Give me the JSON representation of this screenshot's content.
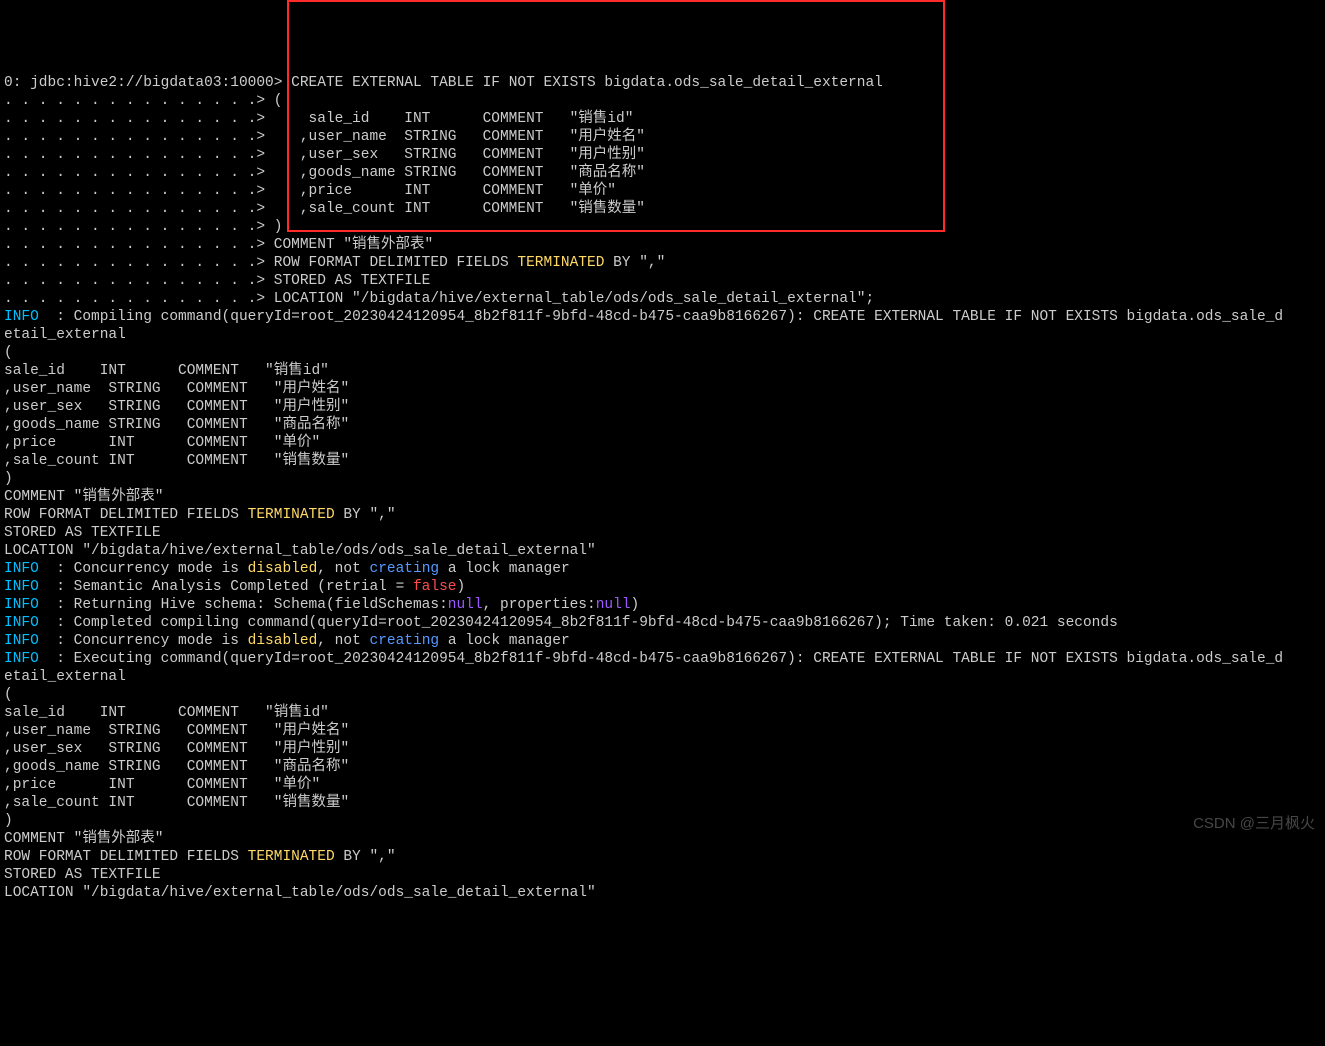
{
  "terminal": {
    "prompt": "0: jdbc:hive2://bigdata03:10000>",
    "continuation": ". . . . . . . . . . . . . . .>",
    "input_lines": [
      " CREATE EXTERNAL TABLE IF NOT EXISTS bigdata.ods_sale_detail_external",
      " (",
      "     sale_id    INT      COMMENT   \"销售id\"",
      "    ,user_name  STRING   COMMENT   \"用户姓名\"",
      "    ,user_sex   STRING   COMMENT   \"用户性别\"",
      "    ,goods_name STRING   COMMENT   \"商品名称\"",
      "    ,price      INT      COMMENT   \"单价\"",
      "    ,sale_count INT      COMMENT   \"销售数量\"",
      " )",
      " COMMENT \"销售外部表\"",
      " ROW FORMAT DELIMITED FIELDS ",
      "TERMINATED",
      " BY \",\"",
      " STORED AS TEXTFILE",
      " LOCATION \"/bigdata/hive/external_table/ods/ods_sale_detail_external\";"
    ],
    "log_compiling_prefix": "  : Compiling command(queryId=root_20230424120954_8b2f811f-9bfd-48cd-b475-caa9b8166267): CREATE EXTERNAL TABLE IF NOT EXISTS bigdata.ods_sale_d",
    "log_compiling_wrap": "etail_external",
    "echo_lines": [
      "(",
      "sale_id    INT      COMMENT   \"销售id\"",
      ",user_name  STRING   COMMENT   \"用户姓名\"",
      ",user_sex   STRING   COMMENT   \"用户性别\"",
      ",goods_name STRING   COMMENT   \"商品名称\"",
      ",price      INT      COMMENT   \"单价\"",
      ",sale_count INT      COMMENT   \"销售数量\"",
      ")",
      "COMMENT \"销售外部表\""
    ],
    "rowformat_prefix": "ROW FORMAT DELIMITED FIELDS ",
    "terminated": "TERMINATED",
    "rowformat_suffix": " BY \",\"",
    "stored": "STORED AS TEXTFILE",
    "location": "LOCATION \"/bigdata/hive/external_table/ods/ods_sale_detail_external\"",
    "info_label": "INFO",
    "log_concurrency_a": "  : Concurrency mode is ",
    "disabled": "disabled",
    "log_concurrency_b": ", not ",
    "creating": "creating",
    "log_concurrency_c": " a lock manager",
    "log_semantic_a": "  : Semantic Analysis Completed (retrial = ",
    "false": "false",
    "log_semantic_b": ")",
    "log_schema_a": "  : Returning Hive schema: Schema(fieldSchemas:",
    "null": "null",
    "log_schema_b": ", properties:",
    "log_schema_c": ")",
    "log_completed": "  : Completed compiling command(queryId=root_20230424120954_8b2f811f-9bfd-48cd-b475-caa9b8166267); Time taken: 0.021 seconds",
    "log_executing_prefix": "  : Executing command(queryId=root_20230424120954_8b2f811f-9bfd-48cd-b475-caa9b8166267): CREATE EXTERNAL TABLE IF NOT EXISTS bigdata.ods_sale_d"
  },
  "watermark": "CSDN @三月枫火"
}
